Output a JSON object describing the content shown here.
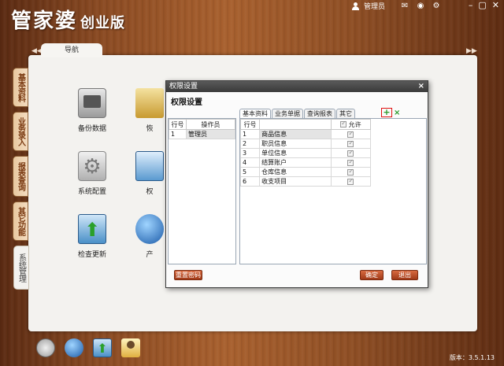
{
  "app": {
    "name": "管家婆",
    "edition": "创业版"
  },
  "topbar": {
    "user_label": "管理员",
    "icons": [
      "mail-icon",
      "weibo-icon",
      "settings-icon"
    ],
    "window_buttons": [
      "minimize",
      "restore",
      "close"
    ]
  },
  "nav": {
    "tab_label": "导航",
    "left_arrow": "◀◀",
    "right_arrow": "▶▶"
  },
  "side_tabs": [
    {
      "label": "基本资料",
      "active": false
    },
    {
      "label": "业务录入",
      "active": false
    },
    {
      "label": "报表查询",
      "active": false
    },
    {
      "label": "其它功能",
      "active": false
    },
    {
      "label": "系统管理",
      "active": true
    }
  ],
  "functions": [
    {
      "label": "备份数据",
      "icon": "backup-disk-icon"
    },
    {
      "label": "恢",
      "icon": "restore-icon"
    },
    {
      "label": "系统配置",
      "icon": "config-gear-icon"
    },
    {
      "label": "权",
      "icon": "permission-icon"
    },
    {
      "label": "检查更新",
      "icon": "check-update-icon"
    },
    {
      "label": "产",
      "icon": "product-globe-icon"
    }
  ],
  "dialog": {
    "title": "权限设置",
    "heading": "权限设置",
    "close_glyph": "×",
    "toolbar": {
      "add_glyph": "+",
      "delete_glyph": "×"
    },
    "left_table": {
      "headers": [
        "行号",
        "操作员"
      ],
      "rows": [
        {
          "no": "1",
          "name": "管理员"
        }
      ]
    },
    "tabs": [
      "基本资料",
      "业务单据",
      "查询报表",
      "其它"
    ],
    "right_table": {
      "headers": [
        "行号",
        "",
        "允许"
      ],
      "rows": [
        {
          "no": "1",
          "name": "商品信息",
          "allowed": true
        },
        {
          "no": "2",
          "name": "职员信息",
          "allowed": true
        },
        {
          "no": "3",
          "name": "单位信息",
          "allowed": true
        },
        {
          "no": "4",
          "name": "结算账户",
          "allowed": true
        },
        {
          "no": "5",
          "name": "仓库信息",
          "allowed": true
        },
        {
          "no": "6",
          "name": "收支项目",
          "allowed": true
        }
      ]
    },
    "buttons": {
      "reset_password": "重置密码",
      "confirm": "确定",
      "exit": "退出"
    }
  },
  "dock": [
    "backup-dock-icon",
    "globe-dock-icon",
    "update-dock-icon",
    "user-dock-icon"
  ],
  "version": "版本：3.5.1.13",
  "colors": {
    "accent": "#b4502a",
    "wood": "#8a4a22",
    "panel": "#f3f2ef"
  }
}
